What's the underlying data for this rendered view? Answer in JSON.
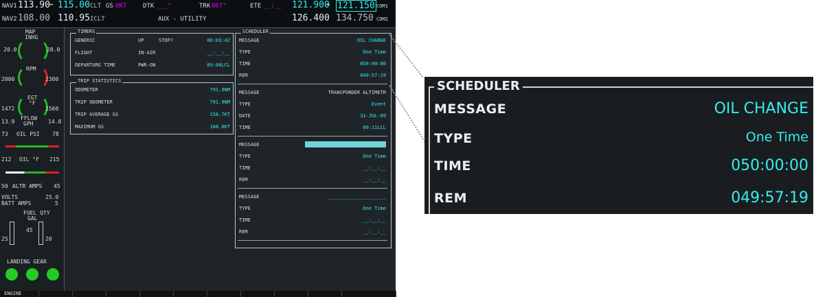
{
  "topbar": {
    "nav1_label": "NAV1",
    "nav1_active": "113.90",
    "nav1_standby": "115.00",
    "nav1_id": "CLT",
    "nav2_label": "NAV2",
    "nav2_active": "108.00",
    "nav2_standby": "110.95",
    "nav2_id": "ICLT",
    "gs_label": "GS",
    "gs_value": "0KT",
    "dtk_label": "DTK",
    "dtk_value": "___°",
    "trk_label": "TRK",
    "trk_value": "007°",
    "ete_label": "ETE",
    "ete_value": "__:__",
    "com1_active": "121.900",
    "com1_standby": "121.150",
    "com1_label": "COM1",
    "com2_active": "126.400",
    "com2_standby": "134.750",
    "com2_label": "COM2",
    "swap_arrow": "↔",
    "page_title": "AUX - UTILITY"
  },
  "engine": {
    "map_label": "MAP",
    "map_unit": "INHG",
    "map_left": "20.0",
    "map_right": "28.0",
    "rpm_label": "RPM",
    "rpm_left": "2000",
    "rpm_right": "2300",
    "egt_label": "EGT",
    "egt_unit": "°F",
    "egt_left": "1472",
    "egt_right": "1560",
    "fflow_label": "FFLOW",
    "fflow_unit": "GPH",
    "fflow_left": "13.9",
    "fflow_right": "14.8",
    "oil_psi_label": "OIL PSI",
    "oil_psi_left": "73",
    "oil_psi_right": "78",
    "oil_f_label": "OIL °F",
    "oil_f_left": "212",
    "oil_f_right": "215",
    "altr_label": "ALTR AMPS",
    "altr_left": "50",
    "altr_right": "45",
    "volts_label": "VOLTS",
    "volts_value": "25.0",
    "batt_label": "BATT AMPS",
    "batt_value": "5",
    "fuel_label": "FUEL QTY",
    "fuel_unit": "GAL",
    "fuel_left": "25",
    "fuel_mid": "45",
    "fuel_right": "20",
    "gear_label": "LANDING GEAR",
    "softkey_engine": "ENGINE"
  },
  "timers": {
    "title": "TIMERS",
    "rows": [
      {
        "label": "GENERIC",
        "mid": "UP",
        "mid2": "STOP?",
        "value": "00:03:42"
      },
      {
        "label": "FLIGHT",
        "mid": "IN-AIR",
        "value": "__:__:__"
      },
      {
        "label": "DEPARTURE TIME",
        "mid": "PWR-ON",
        "value": "09:08LCL"
      }
    ]
  },
  "trip": {
    "title": "TRIP STATISTICS",
    "rows": [
      {
        "label": "ODOMETER",
        "value": "791.9NM"
      },
      {
        "label": "TRIP ODOMETER",
        "value": "791.9NM"
      },
      {
        "label": "TRIP AVERAGE GS",
        "value": "158.7KT"
      },
      {
        "label": "MAXIMUM GS",
        "value": "168.0KT"
      }
    ]
  },
  "scheduler": {
    "title": "SCHEDULER",
    "groups": [
      [
        {
          "label": "MESSAGE",
          "value": "OIL CHANGE"
        },
        {
          "label": "TYPE",
          "value": "One Time"
        },
        {
          "label": "TIME",
          "value": "050:00:00"
        },
        {
          "label": "REM",
          "value": "049:57:19"
        }
      ],
      [
        {
          "label": "MESSAGE",
          "value": "TRANSPONDER ALTIMETR"
        },
        {
          "label": "TYPE",
          "value": "Event"
        },
        {
          "label": "DATE",
          "value": "31-JUL-09"
        },
        {
          "label": "TIME",
          "value": "09:11LCL"
        }
      ],
      [
        {
          "label": "MESSAGE",
          "value": ""
        },
        {
          "label": "TYPE",
          "value": "One Time"
        },
        {
          "label": "TIME",
          "value": "__:__:__"
        },
        {
          "label": "REM",
          "value": "__:__:__"
        }
      ],
      [
        {
          "label": "MESSAGE",
          "value": "____________________"
        },
        {
          "label": "TYPE",
          "value": "One Time"
        },
        {
          "label": "TIME",
          "value": "__:__:__"
        },
        {
          "label": "REM",
          "value": "__:__:__"
        }
      ]
    ]
  },
  "zoom": {
    "title": "SCHEDULER",
    "rows": [
      {
        "label": "MESSAGE",
        "value": "OIL CHANGE"
      },
      {
        "label": "TYPE",
        "value": "One Time"
      },
      {
        "label": "TIME",
        "value": "050:00:00"
      },
      {
        "label": "REM",
        "value": "049:57:19"
      }
    ]
  },
  "colors": {
    "value_cyan": "#33eeee",
    "frame_bg": "#1f2428",
    "gauge_green": "#22bb22",
    "alert_red": "#dd2222"
  }
}
